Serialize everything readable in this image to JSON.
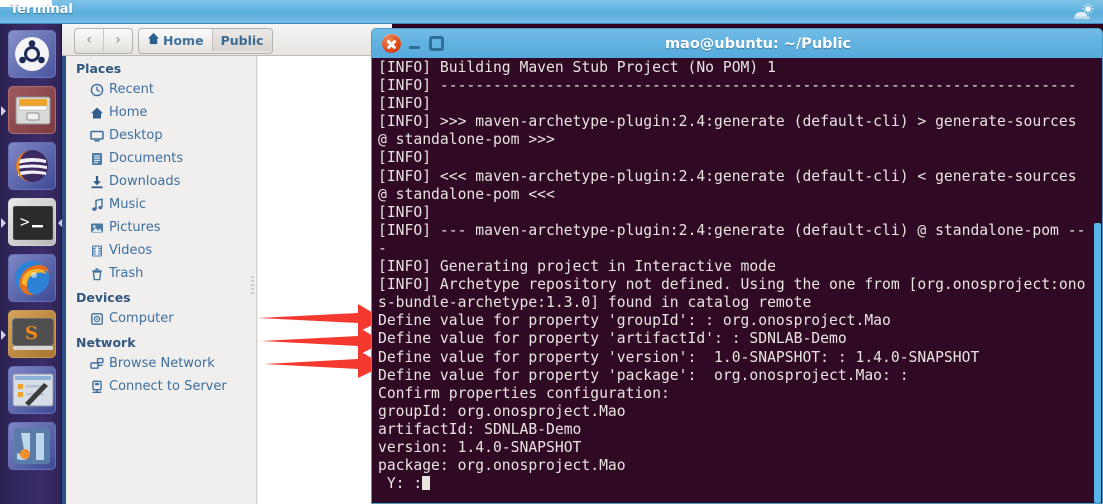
{
  "top_panel": {
    "title": "Terminal",
    "indicator_icon": "system-indicator-icon"
  },
  "launcher": {
    "items": [
      {
        "name": "ubuntu-dash-icon",
        "label": "Ubuntu Dash"
      },
      {
        "name": "files-nautilus-icon",
        "label": "Files"
      },
      {
        "name": "eclipse-icon",
        "label": "Eclipse"
      },
      {
        "name": "terminal-icon",
        "label": "Terminal"
      },
      {
        "name": "firefox-icon",
        "label": "Firefox"
      },
      {
        "name": "sublime-text-icon",
        "label": "Sublime Text"
      },
      {
        "name": "screenshot-tool-icon",
        "label": "Screenshot Tool"
      },
      {
        "name": "intellij-idea-icon",
        "label": "IntelliJ IDEA"
      }
    ]
  },
  "file_manager": {
    "toolbar": {
      "back_label": "‹",
      "forward_label": "›",
      "breadcrumbs": [
        {
          "label": "Home",
          "icon": "home-icon",
          "active": false
        },
        {
          "label": "Public",
          "icon": "",
          "active": true
        }
      ]
    },
    "sidebar": {
      "groups": [
        {
          "heading": "Places",
          "items": [
            {
              "label": "Recent",
              "icon": "clock-icon"
            },
            {
              "label": "Home",
              "icon": "home-icon"
            },
            {
              "label": "Desktop",
              "icon": "desktop-icon"
            },
            {
              "label": "Documents",
              "icon": "documents-icon"
            },
            {
              "label": "Downloads",
              "icon": "download-icon"
            },
            {
              "label": "Music",
              "icon": "music-note-icon"
            },
            {
              "label": "Pictures",
              "icon": "picture-icon"
            },
            {
              "label": "Videos",
              "icon": "video-film-icon"
            },
            {
              "label": "Trash",
              "icon": "trash-icon"
            }
          ]
        },
        {
          "heading": "Devices",
          "items": [
            {
              "label": "Computer",
              "icon": "computer-drive-icon"
            }
          ]
        },
        {
          "heading": "Network",
          "items": [
            {
              "label": "Browse Network",
              "icon": "network-browse-icon"
            },
            {
              "label": "Connect to Server",
              "icon": "server-connect-icon"
            }
          ]
        }
      ]
    }
  },
  "annotations": {
    "arrow_color": "#f4392f",
    "arrow_count": 3
  },
  "terminal": {
    "title": "mao@ubuntu: ~/Public",
    "colors": {
      "background": "#300a24",
      "foreground": "#e8e4df",
      "titlebar": "#61b2e0",
      "close_button": "#dd4814"
    },
    "buttons": {
      "close": "close-icon",
      "minimize": "minimize-icon",
      "maximize": "maximize-icon"
    },
    "lines": [
      "[INFO] Building Maven Stub Project (No POM) 1",
      "[INFO] ------------------------------------------------------------------------",
      "[INFO]",
      "[INFO] >>> maven-archetype-plugin:2.4:generate (default-cli) > generate-sources",
      "@ standalone-pom >>>",
      "[INFO]",
      "[INFO] <<< maven-archetype-plugin:2.4:generate (default-cli) < generate-sources",
      "@ standalone-pom <<<",
      "[INFO]",
      "[INFO] --- maven-archetype-plugin:2.4:generate (default-cli) @ standalone-pom --",
      "-",
      "[INFO] Generating project in Interactive mode",
      "[INFO] Archetype repository not defined. Using the one from [org.onosproject:ono",
      "s-bundle-archetype:1.3.0] found in catalog remote",
      "Define value for property 'groupId': : org.onosproject.Mao",
      "Define value for property 'artifactId': : SDNLAB-Demo",
      "Define value for property 'version':  1.0-SNAPSHOT: : 1.4.0-SNAPSHOT",
      "Define value for property 'package':  org.onosproject.Mao: :",
      "Confirm properties configuration:",
      "groupId: org.onosproject.Mao",
      "artifactId: SDNLAB-Demo",
      "version: 1.4.0-SNAPSHOT",
      "package: org.onosproject.Mao",
      " Y: :"
    ]
  }
}
